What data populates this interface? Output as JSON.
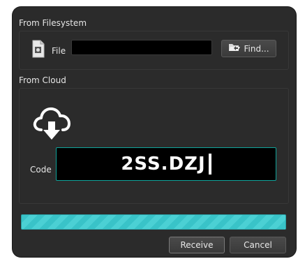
{
  "filesystem": {
    "title": "From Filesystem",
    "file_label": "File",
    "file_value": "",
    "find_label": "Find..."
  },
  "cloud": {
    "title": "From Cloud",
    "code_label": "Code",
    "code_value": "2SS.DZJ"
  },
  "progress": {
    "value": 1.0
  },
  "buttons": {
    "receive": "Receive",
    "cancel": "Cancel"
  },
  "colors": {
    "accent": "#39c3c8",
    "focus_border": "#0fa39a"
  },
  "icons": {
    "file": "file-icon",
    "cloud": "cloud-download-icon",
    "find": "folder-open-icon"
  }
}
